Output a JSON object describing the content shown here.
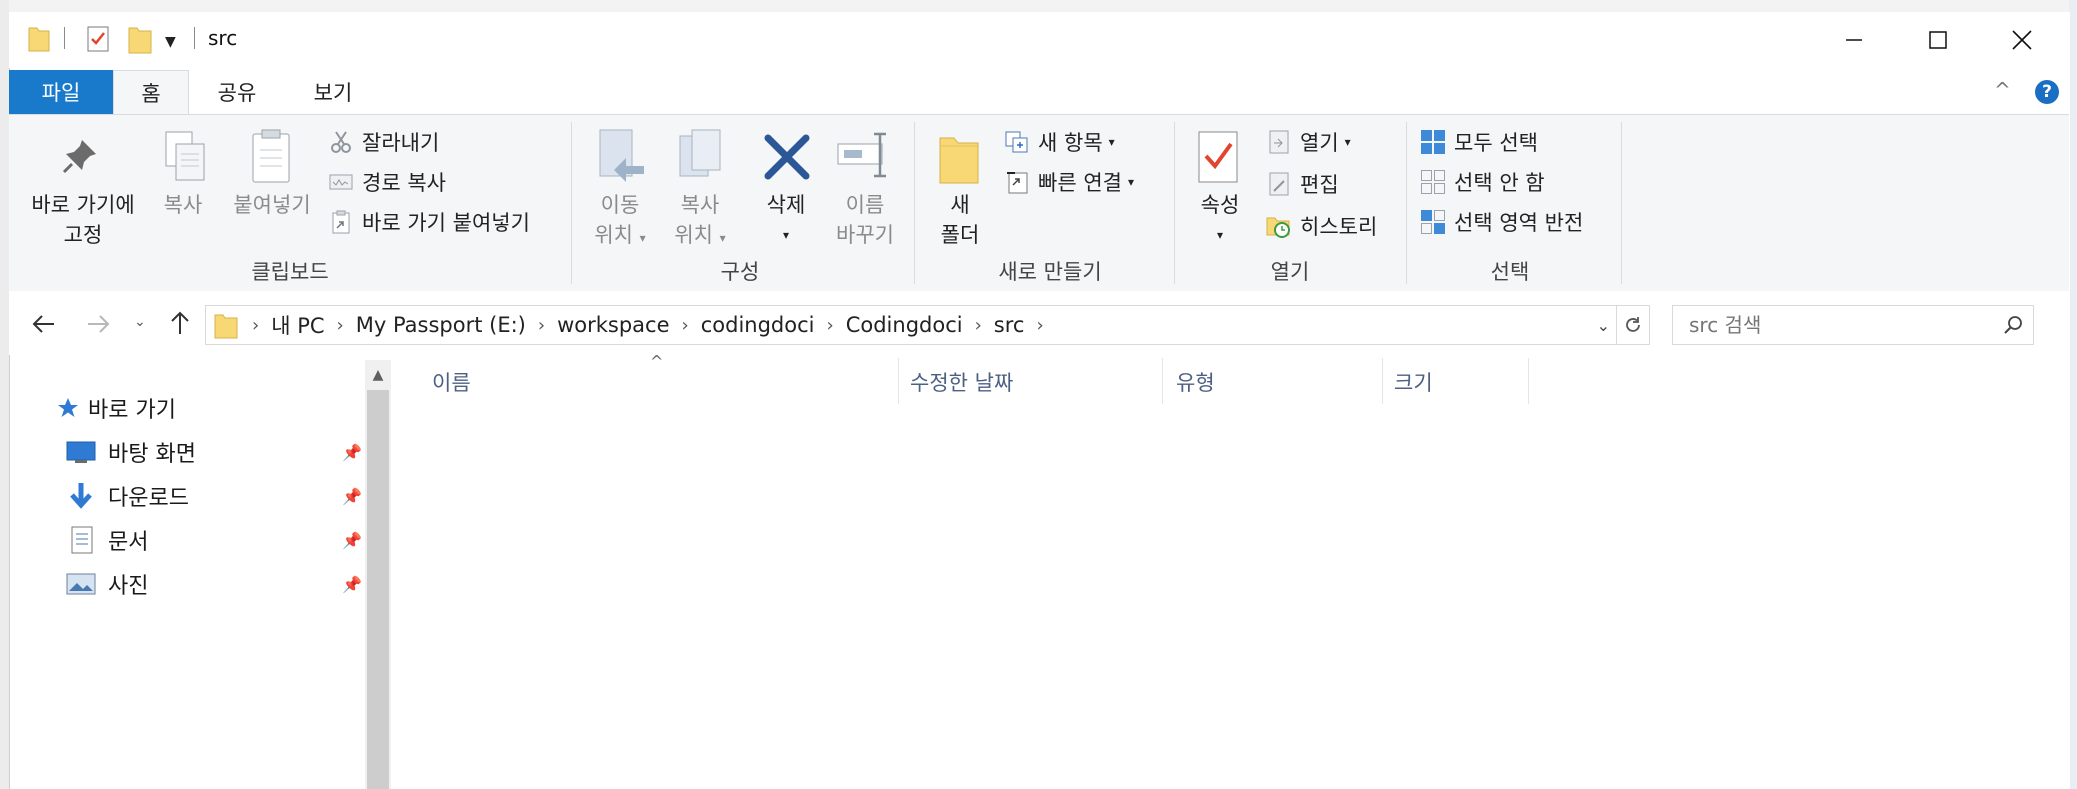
{
  "window": {
    "title": "src"
  },
  "tabs": [
    {
      "label": "파일"
    },
    {
      "label": "홈"
    },
    {
      "label": "공유"
    },
    {
      "label": "보기"
    }
  ],
  "ribbon": {
    "clipboard": {
      "group_label": "클립보드",
      "pin_label_1": "바로 가기에",
      "pin_label_2": "고정",
      "copy": "복사",
      "paste": "붙여넣기",
      "cut": "잘라내기",
      "copy_path": "경로 복사",
      "paste_shortcut": "바로 가기 붙여넣기"
    },
    "organize": {
      "group_label": "구성",
      "move_1": "이동",
      "move_2": "위치",
      "copy_1": "복사",
      "copy_2": "위치",
      "delete": "삭제",
      "rename_1": "이름",
      "rename_2": "바꾸기"
    },
    "new": {
      "group_label": "새로 만들기",
      "new_folder_1": "새",
      "new_folder_2": "폴더",
      "new_item": "새 항목",
      "easy_access": "빠른 연결"
    },
    "open": {
      "group_label": "열기",
      "properties": "속성",
      "open": "열기",
      "edit": "편집",
      "history": "히스토리"
    },
    "select": {
      "group_label": "선택",
      "select_all": "모두 선택",
      "select_none": "선택 안 함",
      "invert": "선택 영역 반전"
    }
  },
  "address": {
    "crumbs": [
      "내 PC",
      "My Passport (E:)",
      "workspace",
      "codingdoci",
      "Codingdoci",
      "src"
    ]
  },
  "search": {
    "placeholder": "src 검색"
  },
  "nav": {
    "quick_access": "바로 가기",
    "items": [
      {
        "label": "바탕 화면"
      },
      {
        "label": "다운로드"
      },
      {
        "label": "문서"
      },
      {
        "label": "사진"
      }
    ]
  },
  "columns": {
    "name": "이름",
    "modified": "수정한 날짜",
    "type": "유형",
    "size": "크기"
  },
  "colors": {
    "file_tab": "#1979ca",
    "accent_blue": "#2f7bd4",
    "delete_x": "#2b5797"
  }
}
